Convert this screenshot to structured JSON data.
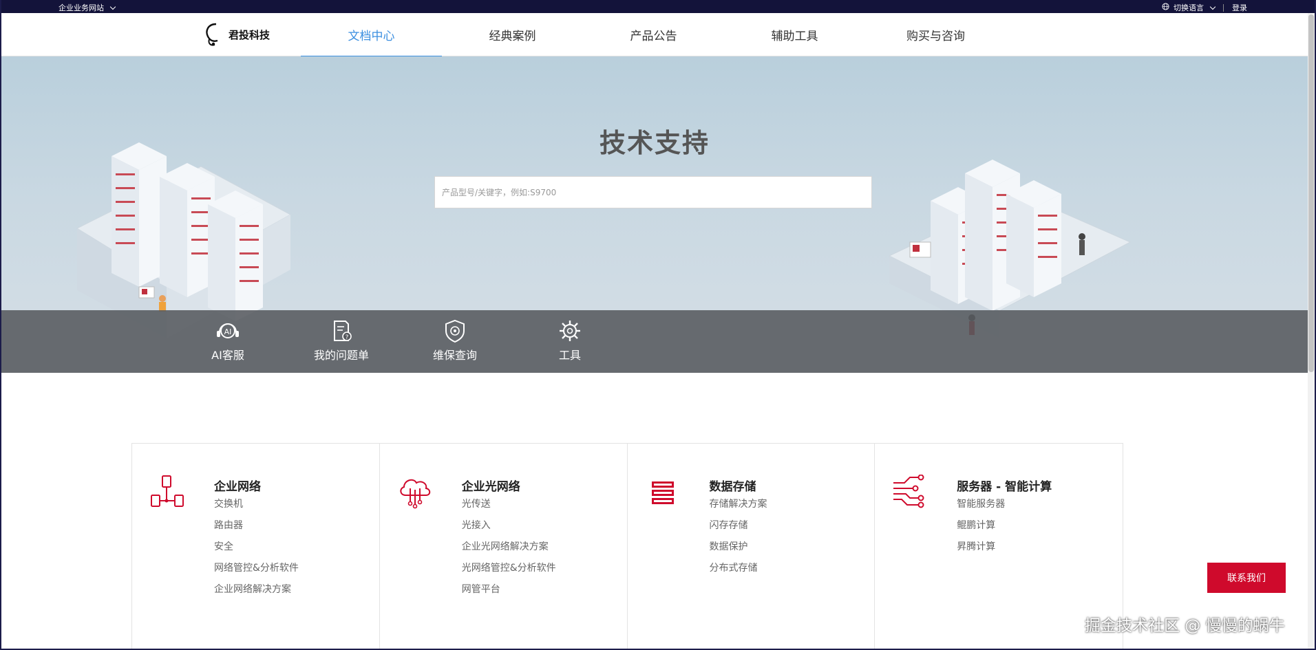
{
  "topbar": {
    "site_label": "企业业务网站",
    "language_label": "切换语言",
    "login_label": "登录"
  },
  "brand": {
    "logo_text": "君投科技"
  },
  "nav": {
    "tabs": [
      {
        "label": "文档中心",
        "active": true
      },
      {
        "label": "经典案例",
        "active": false
      },
      {
        "label": "产品公告",
        "active": false
      },
      {
        "label": "辅助工具",
        "active": false
      },
      {
        "label": "购买与咨询",
        "active": false
      }
    ]
  },
  "hero": {
    "title": "技术支持",
    "search_placeholder": "产品型号/关键字，例如:S9700"
  },
  "quick_links": [
    {
      "label": "AI客服",
      "icon": "ai-service-icon"
    },
    {
      "label": "我的问题单",
      "icon": "ticket-icon"
    },
    {
      "label": "维保查询",
      "icon": "shield-icon"
    },
    {
      "label": "工具",
      "icon": "tools-icon"
    }
  ],
  "categories": [
    {
      "title": "企业网络",
      "icon": "network-icon",
      "links": [
        "交换机",
        "路由器",
        "安全",
        "网络管控&分析软件",
        "企业网络解决方案"
      ]
    },
    {
      "title": "企业光网络",
      "icon": "cloud-icon",
      "links": [
        "光传送",
        "光接入",
        "企业光网络解决方案",
        "光网络管控&分析软件",
        "网管平台"
      ]
    },
    {
      "title": "数据存储",
      "icon": "storage-icon",
      "links": [
        "存储解决方案",
        "闪存存储",
        "数据保护",
        "分布式存储"
      ]
    },
    {
      "title": "服务器 - 智能计算",
      "icon": "server-icon",
      "links": [
        "智能服务器",
        "鲲鹏计算",
        "昇腾计算"
      ]
    }
  ],
  "contact_label": "联系我们",
  "watermark": "掘金技术社区 @ 慢慢的蜗牛",
  "colors": {
    "accent_blue": "#3b8fe0",
    "brand_red": "#cf0a2c",
    "topbar": "#13133a"
  }
}
